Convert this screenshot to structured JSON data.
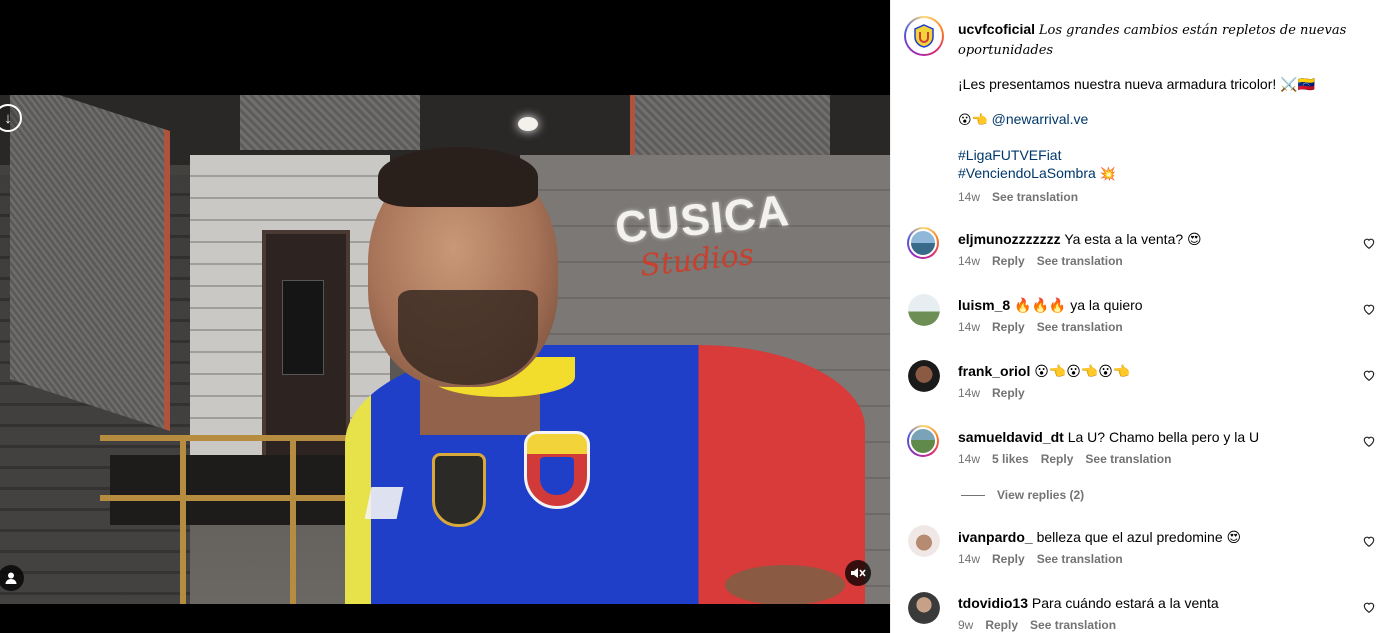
{
  "post": {
    "author": "ucvfcoficial",
    "caption_line1": "Los grandes cambios están repletos de nuevas",
    "caption_line2": "oportunidades",
    "body": "¡Les presentamos nuestra nueva armadura tricolor! ⚔️🇻🇪",
    "mention_prefix": "😮👈",
    "mention": "@newarrival.ve",
    "hashtag1": "#LigaFUTVEFiat",
    "hashtag2": "#VenciendoLaSombra",
    "hashtag2_emoji": "💥",
    "age": "14w",
    "see_translation": "See translation"
  },
  "video": {
    "brand_text": "CUSICA",
    "brand_script": "Studios"
  },
  "comments": [
    {
      "user": "eljmunozzzzzzz",
      "text": "Ya esta a la venta? 😍",
      "age": "14w",
      "reply": "Reply",
      "translate": "See translation"
    },
    {
      "user": "luism_8",
      "text": "🔥🔥🔥 ya la quiero",
      "age": "14w",
      "reply": "Reply",
      "translate": "See translation"
    },
    {
      "user": "frank_oriol",
      "text": "😮👈😮👈😮👈",
      "age": "14w",
      "reply": "Reply"
    },
    {
      "user": "samueldavid_dt",
      "text": "La U? Chamo bella pero y la U",
      "age": "14w",
      "likes": "5 likes",
      "reply": "Reply",
      "translate": "See translation",
      "view_replies": "View replies (2)"
    },
    {
      "user": "ivanpardo_",
      "text": "belleza que el azul predomine 😍",
      "age": "14w",
      "reply": "Reply",
      "translate": "See translation"
    },
    {
      "user": "tdovidio13",
      "text": "Para cuándo estará a la venta",
      "age": "9w",
      "reply": "Reply",
      "translate": "See translation"
    }
  ],
  "colors": {
    "accent_blue": "#00376b",
    "meta_gray": "#737373"
  }
}
